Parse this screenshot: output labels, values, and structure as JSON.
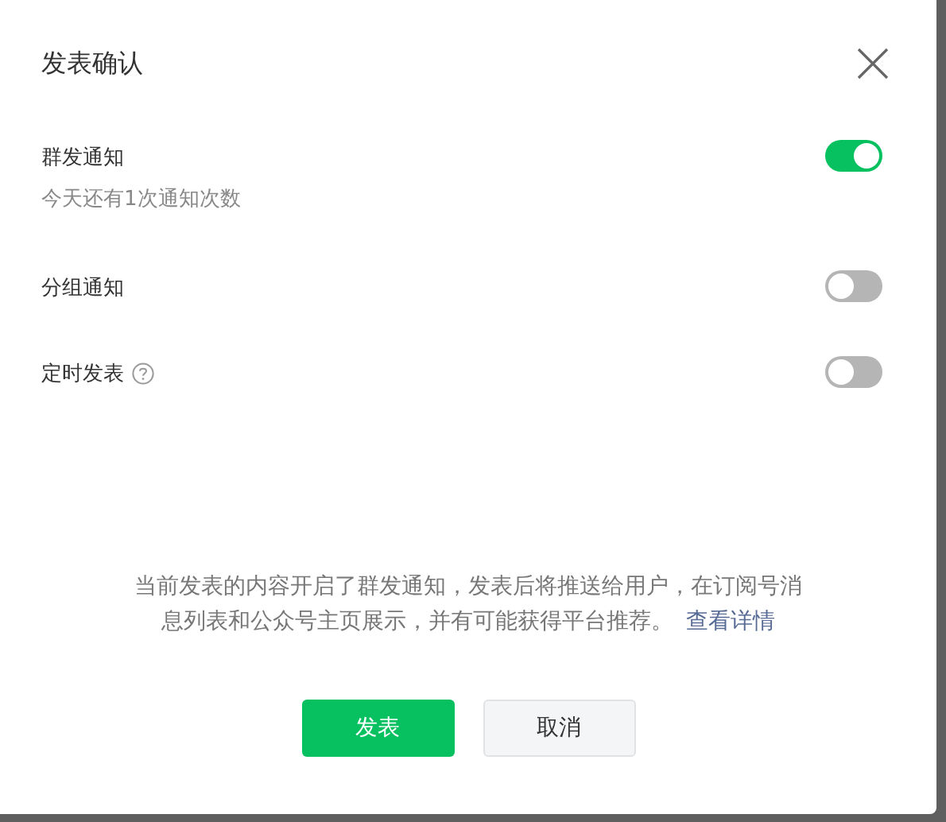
{
  "dialog": {
    "title": "发表确认"
  },
  "options": [
    {
      "label": "群发通知",
      "subtitle": "今天还有1次通知次数",
      "help": false,
      "on": true
    },
    {
      "label": "分组通知",
      "help": false,
      "on": false
    },
    {
      "label": "定时发表",
      "help": true,
      "on": false
    }
  ],
  "notice": {
    "text": "当前发表的内容开启了群发通知，发表后将推送给用户，在订阅号消息列表和公众号主页展示，并有可能获得平台推荐。",
    "link": "查看详情"
  },
  "buttons": [
    {
      "label": "发表",
      "kind": "primary"
    },
    {
      "label": "取消",
      "kind": "secondary"
    }
  ]
}
